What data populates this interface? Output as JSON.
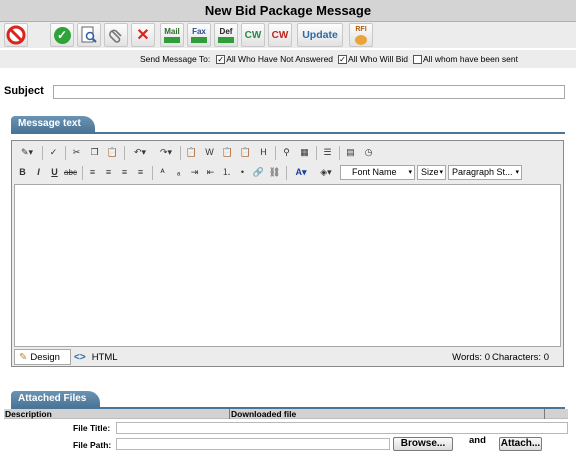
{
  "window": {
    "title": "New Bid Package Message"
  },
  "toolbar": {
    "cw_label": "CW",
    "update_label": "Update",
    "mail_label": "Mail",
    "fax_label": "Fax",
    "def_label": "Def",
    "rfi_label": "RFI"
  },
  "send_to": {
    "label": "Send Message To:",
    "options": [
      {
        "label": "All Who Have Not Answered",
        "checked": true
      },
      {
        "label": "All Who Will Bid",
        "checked": true
      },
      {
        "label": "All whom have been sent",
        "checked": false
      }
    ]
  },
  "subject": {
    "label": "Subject",
    "value": ""
  },
  "message": {
    "tab_label": "Message text",
    "font_name": "Font Name",
    "size": "Size",
    "paragraph": "Paragraph St...",
    "mode_design": "Design",
    "mode_html": "HTML",
    "words_label": "Words: 0",
    "chars_label": "Characters: 0"
  },
  "attachments": {
    "tab_label": "Attached Files",
    "columns": [
      "Description",
      "Downloaded file"
    ],
    "file_title_label": "File Title:",
    "file_path_label": "File Path:",
    "browse_label": "Browse...",
    "and_label": "and",
    "attach_label": "Attach..."
  },
  "colors": {
    "tab_blue": "#4b7597",
    "cancel_red": "#d9261c",
    "ok_green": "#2fa33a"
  }
}
